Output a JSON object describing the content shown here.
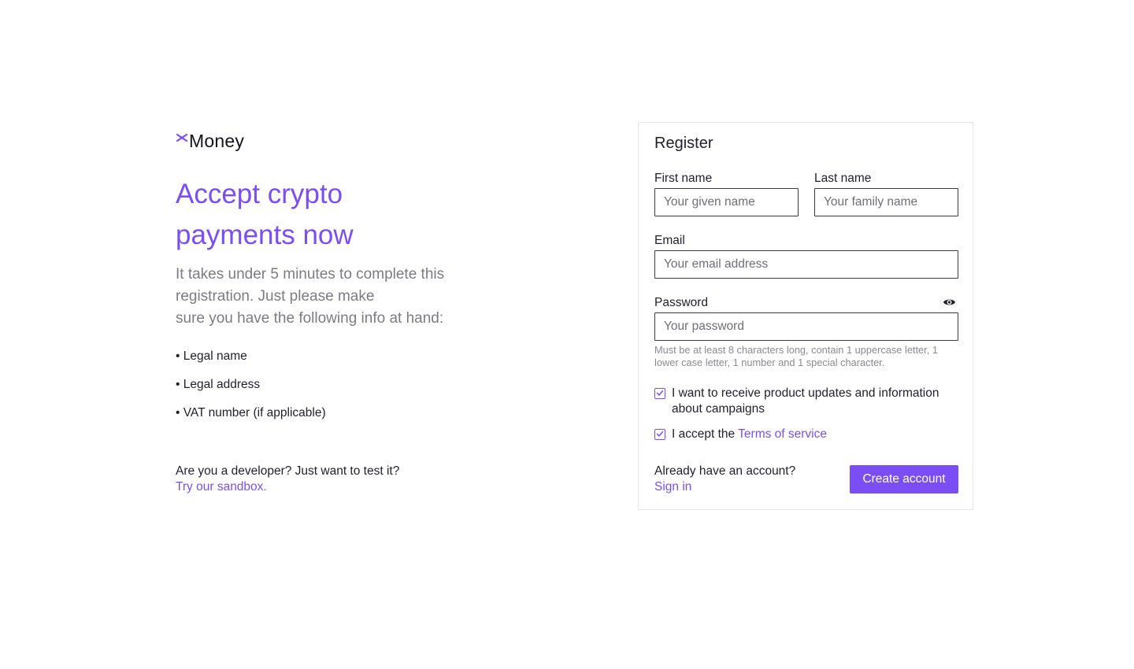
{
  "brand": {
    "logo_text": "Money",
    "accent_color": "#7b4ef5"
  },
  "hero": {
    "headline": "Accept crypto payments now",
    "intro_lines": [
      "It takes under 5 minutes to complete this",
      "registration. Just please make",
      "sure you have the following info at hand:"
    ],
    "bullets": [
      "• Legal name",
      "• Legal address",
      "• VAT number (if applicable)"
    ]
  },
  "developer": {
    "question": "Are you a developer? Just want to test it?",
    "link": "Try our sandbox."
  },
  "register": {
    "title": "Register",
    "first_name": {
      "label": "First name",
      "placeholder": "Your given name",
      "value": ""
    },
    "last_name": {
      "label": "Last name",
      "placeholder": "Your family name",
      "value": ""
    },
    "email": {
      "label": "Email",
      "placeholder": "Your email address",
      "value": ""
    },
    "password": {
      "label": "Password",
      "placeholder": "Your password",
      "value": "",
      "toggle_icon": "eye-icon",
      "hint": "Must be at least 8 characters long, contain 1 uppercase letter, 1 lower case letter, 1 number and 1 special character."
    },
    "consent_updates": {
      "checked": true,
      "label": "I want to receive product updates and information about campaigns"
    },
    "consent_terms": {
      "checked": true,
      "prefix": "I accept the",
      "link": "Terms of service"
    },
    "already_account": "Already have an account?",
    "sign_in": "Sign in",
    "create_button": "Create account"
  }
}
